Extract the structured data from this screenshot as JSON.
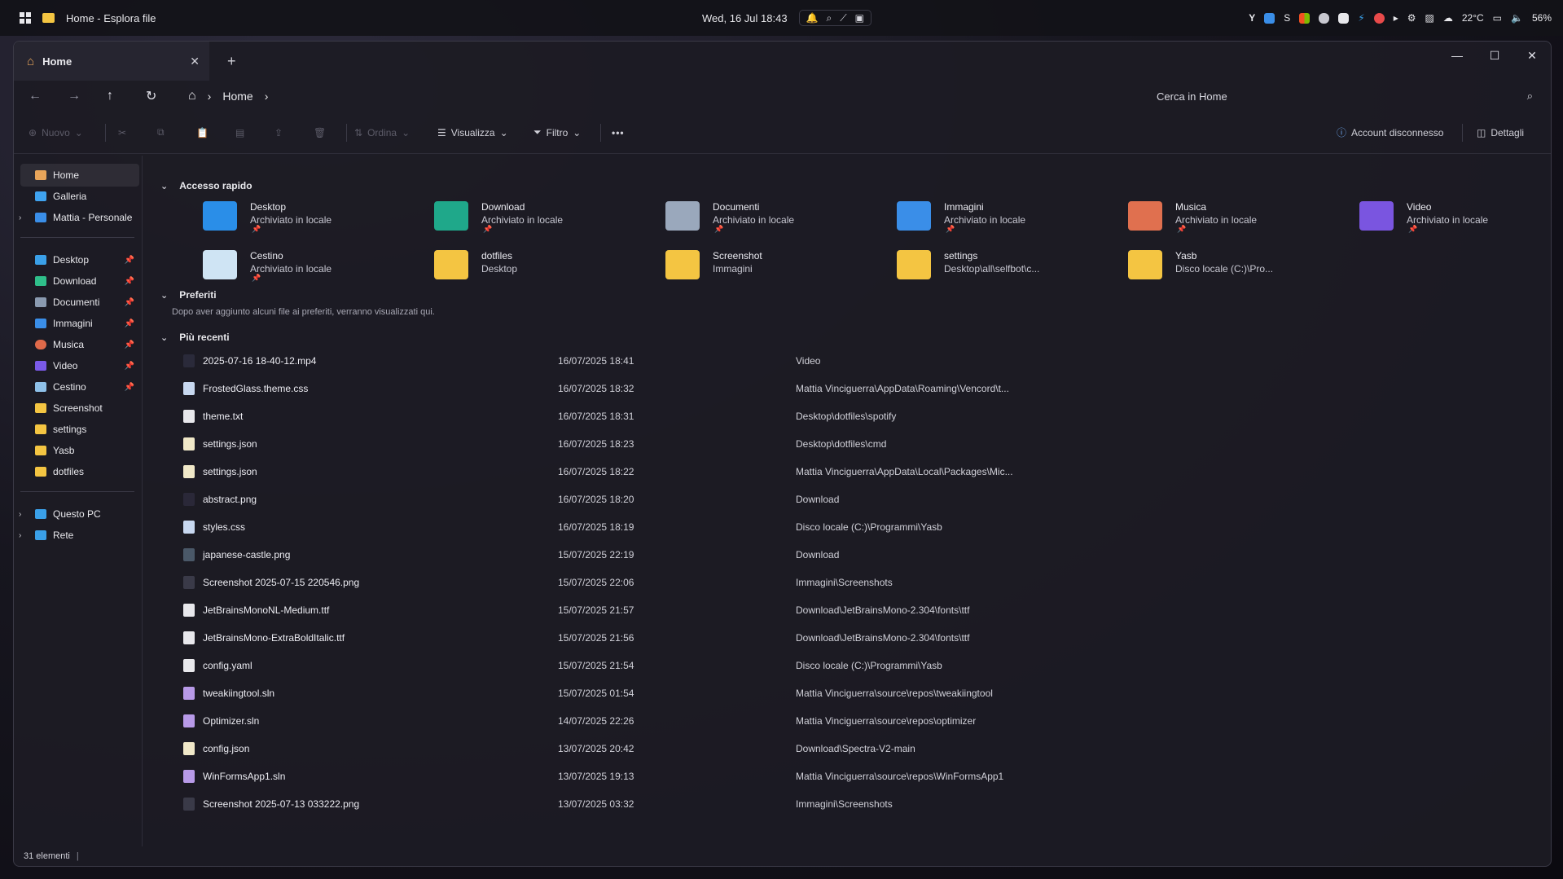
{
  "taskbar": {
    "window_title": "Home - Esplora file",
    "clock": "Wed, 16 Jul 18:43",
    "weather": "22°C",
    "volume": "56%"
  },
  "window": {
    "tab_title": "Home",
    "tab_close": "✕",
    "tab_add": "+"
  },
  "navbar": {
    "breadcrumb_current": "Home",
    "search_placeholder": "Cerca in Home"
  },
  "toolbar": {
    "new_label": "Nuovo",
    "sort_label": "Ordina",
    "view_label": "Visualizza",
    "filter_label": "Filtro",
    "more_label": "•••",
    "account_label": "Account disconnesso",
    "details_label": "Dettagli"
  },
  "sidebar": {
    "items": [
      {
        "label": "Home",
        "color": "#e8a55a"
      },
      {
        "label": "Galleria",
        "color": "#3fa3f0"
      },
      {
        "label": "Mattia - Personale",
        "color": "#3a8ee8"
      },
      {
        "label": "Desktop",
        "color": "#3aa0e8"
      },
      {
        "label": "Download",
        "color": "#2fbf8a"
      },
      {
        "label": "Documenti",
        "color": "#8a9ab0"
      },
      {
        "label": "Immagini",
        "color": "#3a8ee8"
      },
      {
        "label": "Musica",
        "color": "#e06a4a"
      },
      {
        "label": "Video",
        "color": "#7a5ae8"
      },
      {
        "label": "Cestino",
        "color": "#8ec0e8"
      },
      {
        "label": "Screenshot",
        "color": "#f4c542"
      },
      {
        "label": "settings",
        "color": "#f4c542"
      },
      {
        "label": "Yasb",
        "color": "#f4c542"
      },
      {
        "label": "dotfiles",
        "color": "#f4c542"
      },
      {
        "label": "Questo PC",
        "color": "#3aa0e8"
      },
      {
        "label": "Rete",
        "color": "#3aa0e8"
      }
    ]
  },
  "sections": {
    "quick_access": "Accesso rapido",
    "favorites": "Preferiti",
    "favorites_empty": "Dopo aver aggiunto alcuni file ai preferiti, verranno visualizzati qui.",
    "recent": "Più recenti"
  },
  "quick_access": [
    {
      "name": "Desktop",
      "sub": "Archiviato in locale",
      "color": "#2a8ee8"
    },
    {
      "name": "Download",
      "sub": "Archiviato in locale",
      "color": "#1fa88a"
    },
    {
      "name": "Documenti",
      "sub": "Archiviato in locale",
      "color": "#9aa8bc"
    },
    {
      "name": "Immagini",
      "sub": "Archiviato in locale",
      "color": "#3a8ee8"
    },
    {
      "name": "Musica",
      "sub": "Archiviato in locale",
      "color": "#e0704f"
    },
    {
      "name": "Video",
      "sub": "Archiviato in locale",
      "color": "#7a55e0"
    },
    {
      "name": "Cestino",
      "sub": "Archiviato in locale",
      "color": "#cfe4f4"
    },
    {
      "name": "dotfiles",
      "sub": "Desktop",
      "color": "#f4c542"
    },
    {
      "name": "Screenshot",
      "sub": "Immagini",
      "color": "#f4c542"
    },
    {
      "name": "settings",
      "sub": "Desktop\\all\\selfbot\\c...",
      "color": "#f4c542"
    },
    {
      "name": "Yasb",
      "sub": "Disco locale (C:)\\Pro...",
      "color": "#f4c542"
    }
  ],
  "recent_files": [
    {
      "name": "2025-07-16 18-40-12.mp4",
      "date": "16/07/2025 18:41",
      "location": "Video",
      "color": "#2a2a3a"
    },
    {
      "name": "FrostedGlass.theme.css",
      "date": "16/07/2025 18:32",
      "location": "Mattia Vinciguerra\\AppData\\Roaming\\Vencord\\t...",
      "color": "#c8d8f0"
    },
    {
      "name": "theme.txt",
      "date": "16/07/2025 18:31",
      "location": "Desktop\\dotfiles\\spotify",
      "color": "#e8e8ec"
    },
    {
      "name": "settings.json",
      "date": "16/07/2025 18:23",
      "location": "Desktop\\dotfiles\\cmd",
      "color": "#f0e8c8"
    },
    {
      "name": "settings.json",
      "date": "16/07/2025 18:22",
      "location": "Mattia Vinciguerra\\AppData\\Local\\Packages\\Mic...",
      "color": "#f0e8c8"
    },
    {
      "name": "abstract.png",
      "date": "16/07/2025 18:20",
      "location": "Download",
      "color": "#2a2838"
    },
    {
      "name": "styles.css",
      "date": "16/07/2025 18:19",
      "location": "Disco locale (C:)\\Programmi\\Yasb",
      "color": "#c8d8f0"
    },
    {
      "name": "japanese-castle.png",
      "date": "15/07/2025 22:19",
      "location": "Download",
      "color": "#4a5868"
    },
    {
      "name": "Screenshot 2025-07-15 220546.png",
      "date": "15/07/2025 22:06",
      "location": "Immagini\\Screenshots",
      "color": "#3a3a48"
    },
    {
      "name": "JetBrainsMonoNL-Medium.ttf",
      "date": "15/07/2025 21:57",
      "location": "Download\\JetBrainsMono-2.304\\fonts\\ttf",
      "color": "#e8e8ec"
    },
    {
      "name": "JetBrainsMono-ExtraBoldItalic.ttf",
      "date": "15/07/2025 21:56",
      "location": "Download\\JetBrainsMono-2.304\\fonts\\ttf",
      "color": "#e8e8ec"
    },
    {
      "name": "config.yaml",
      "date": "15/07/2025 21:54",
      "location": "Disco locale (C:)\\Programmi\\Yasb",
      "color": "#e8e8ec"
    },
    {
      "name": "tweakiingtool.sln",
      "date": "15/07/2025 01:54",
      "location": "Mattia Vinciguerra\\source\\repos\\tweakiingtool",
      "color": "#b89ae8"
    },
    {
      "name": "Optimizer.sln",
      "date": "14/07/2025 22:26",
      "location": "Mattia Vinciguerra\\source\\repos\\optimizer",
      "color": "#b89ae8"
    },
    {
      "name": "config.json",
      "date": "13/07/2025 20:42",
      "location": "Download\\Spectra-V2-main",
      "color": "#f0e8c8"
    },
    {
      "name": "WinFormsApp1.sln",
      "date": "13/07/2025 19:13",
      "location": "Mattia Vinciguerra\\source\\repos\\WinFormsApp1",
      "color": "#b89ae8"
    },
    {
      "name": "Screenshot 2025-07-13 033222.png",
      "date": "13/07/2025 03:32",
      "location": "Immagini\\Screenshots",
      "color": "#3a3a48"
    }
  ],
  "statusbar": {
    "count": "31 elementi"
  }
}
